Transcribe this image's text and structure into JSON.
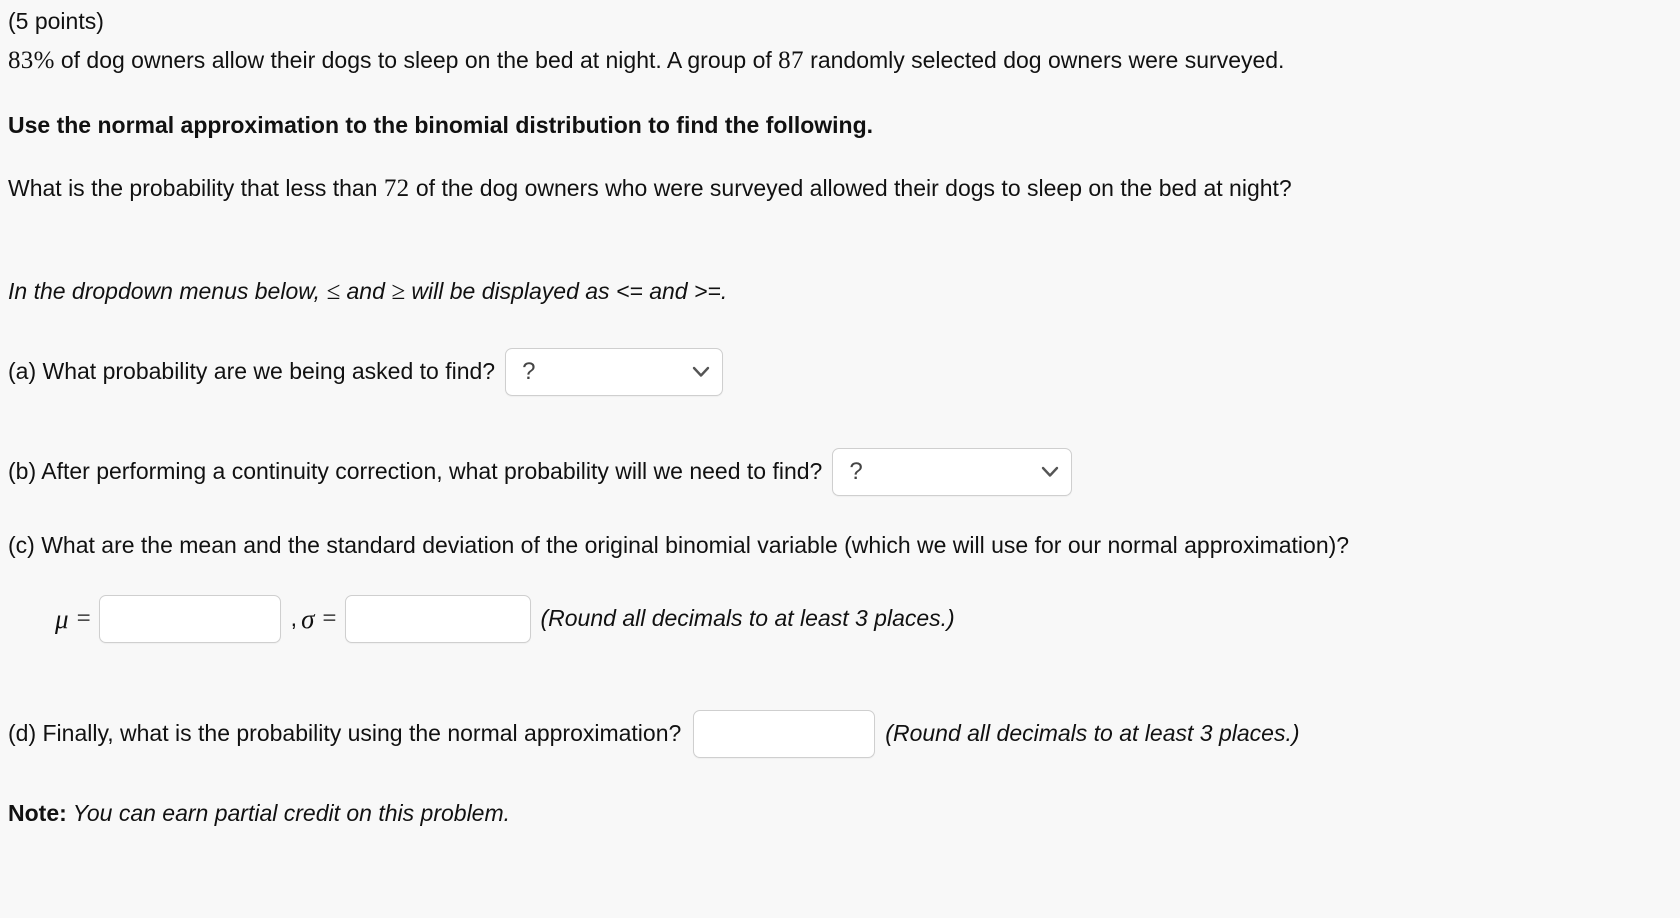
{
  "problem": {
    "points_label": "(5 points)",
    "statement": {
      "percent": "83",
      "percent_suffix": "%",
      "text_before_n": " of dog owners allow their dogs to sleep on the bed at night. A group of ",
      "n": "87",
      "text_after_n": " randomly selected dog owners were surveyed."
    },
    "bold_instruction": "Use the normal approximation to the binomial distribution to find the following.",
    "question": {
      "text_before": "What is the probability that less than ",
      "value": "72",
      "text_after": " of the dog owners who were surveyed allowed their dogs to sleep on the bed at night?"
    },
    "dropdown_note": {
      "before": "In the dropdown menus below, ",
      "leq": "≤",
      "middle_and": " and ",
      "geq": "≥",
      "after": " will be displayed as <= and >=."
    }
  },
  "parts": {
    "a": {
      "label": "(a) What probability are we being asked to find?",
      "dropdown_value": "?",
      "chevron": "chevron-down-icon"
    },
    "b": {
      "label": "(b) After performing a continuity correction, what probability will we need to find?",
      "dropdown_value": "?",
      "chevron": "chevron-down-icon"
    },
    "c": {
      "label": "(c) What are the mean and the standard deviation of the original binomial variable (which we will use for our normal approximation)?",
      "mu_symbol": "μ",
      "equals": "=",
      "mu_value": "",
      "mu_placeholder": "",
      "comma": ",",
      "sigma_symbol": "σ",
      "sigma_value": "",
      "sigma_placeholder": "",
      "round_note": "(Round all decimals to at least 3 places.)"
    },
    "d": {
      "label": "(d) Finally, what is the probability using the normal approximation?",
      "value": "",
      "placeholder": "",
      "round_note": "(Round all decimals to at least 3 places.)"
    }
  },
  "footer": {
    "note_label": "Note",
    "note_colon": ":",
    "note_text": "You can earn partial credit on this problem."
  },
  "colors": {
    "background": "#f8f8f8",
    "text": "#111111",
    "field_border": "#cfcfcf",
    "field_background": "#ffffff",
    "placeholder_text": "#444444"
  }
}
